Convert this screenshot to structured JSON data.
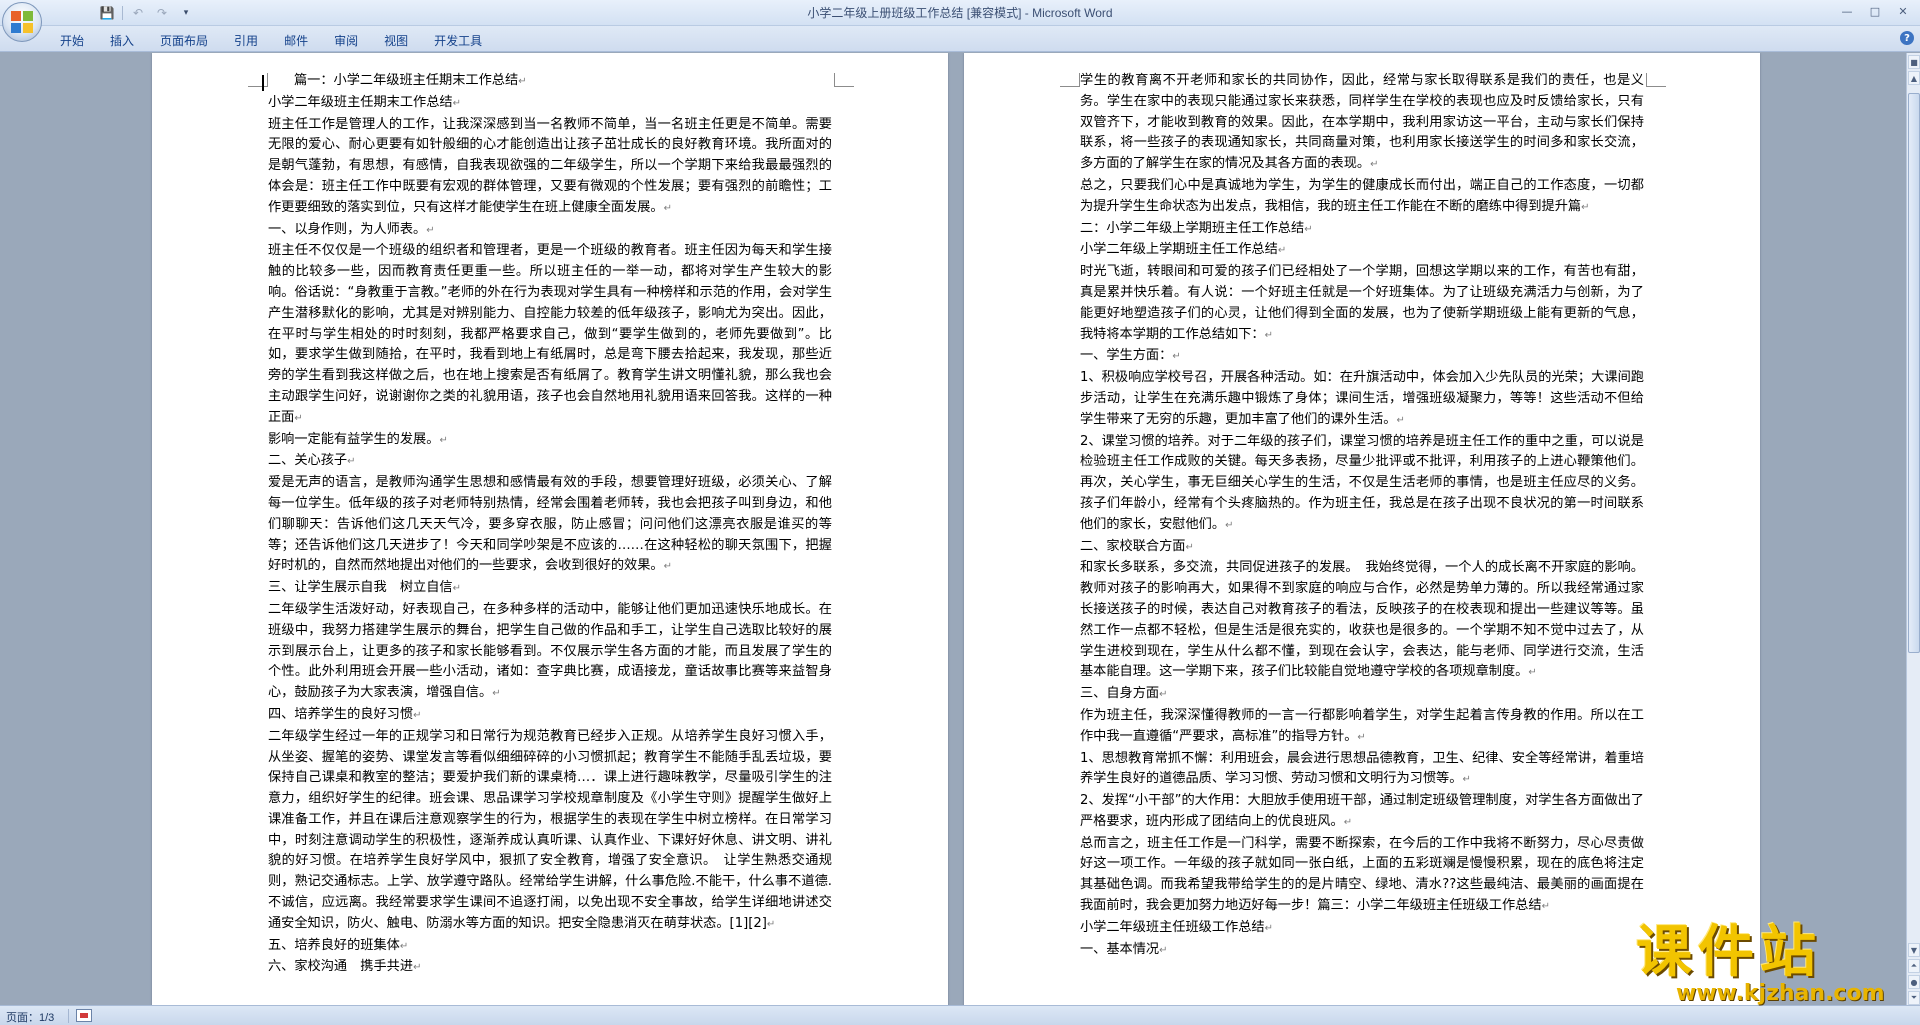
{
  "window": {
    "title": "小学二年级上册班级工作总结 [兼容模式] - ",
    "app_name": "Microsoft Word",
    "controls": {
      "minimize": "—",
      "maximize": "□",
      "close": "✕"
    }
  },
  "quick_access": {
    "save_icon": "save-icon",
    "undo_icon": "undo-icon",
    "redo_icon": "redo-icon",
    "customize_icon": "dropdown-icon"
  },
  "ribbon": {
    "tabs": [
      "开始",
      "插入",
      "页面布局",
      "引用",
      "邮件",
      "审阅",
      "视图",
      "开发工具"
    ],
    "help": "?"
  },
  "left_page": [
    "篇一：小学二年级班主任期末工作总结",
    "小学二年级班主任期末工作总结",
    "班主任工作是管理人的工作，让我深深感到当一名教师不简单，当一名班主任更是不简单。需要无限的爱心、耐心更要有如针般细的心才能创造出让孩子茁壮成长的良好教育环境。我所面对的是朝气蓬勃，有思想，有感情，自我表现欲强的二年级学生，所以一个学期下来给我最最强烈的体会是：班主任工作中既要有宏观的群体管理，又要有微观的个性发展；要有强烈的前瞻性；工作更要细致的落实到位，只有这样才能使学生在班上健康全面发展。",
    "一、以身作则，为人师表。",
    "班主任不仅仅是一个班级的组织者和管理者，更是一个班级的教育者。班主任因为每天和学生接触的比较多一些，因而教育责任更重一些。所以班主任的一举一动，都将对学生产生较大的影响。俗话说：“身教重于言教。”老师的外在行为表现对学生具有一种榜样和示范的作用，会对学生产生潜移默化的影响，尤其是对辨别能力、自控能力较差的低年级孩子，影响尤为突出。因此，在平时与学生相处的时时刻刻，我都严格要求自己，做到“要学生做到的，老师先要做到”。比如，要求学生做到随拾，在平时，我看到地上有纸屑时，总是弯下腰去拾起来，我发现，那些近旁的学生看到我这样做之后，也在地上搜索是否有纸屑了。教育学生讲文明懂礼貌，那么我也会主动跟学生问好，说谢谢你之类的礼貌用语，孩子也会自然地用礼貌用语来回答我。这样的一种正面",
    "影响一定能有益学生的发展。",
    "二、关心孩子",
    "爱是无声的语言，是教师沟通学生思想和感情最有效的手段，想要管理好班级，必须关心、了解每一位学生。低年级的孩子对老师特别热情，经常会围着老师转，我也会把孩子叫到身边，和他们聊聊天：告诉他们这几天天气冷，要多穿衣服，防止感冒；问问他们这漂亮衣服是谁买的等等；还告诉他们这几天进步了！今天和同学吵架是不应该的……在这种轻松的聊天氛围下，把握好时机的，自然而然地提出对他们的一些要求，会收到很好的效果。",
    "三、让学生展示自我　树立自信",
    "二年级学生活泼好动，好表现自己，在多种多样的活动中，能够让他们更加迅速快乐地成长。在班级中，我努力搭建学生展示的舞台，把学生自己做的作品和手工，让学生自己选取比较好的展示到展示台上，让更多的孩子和家长能够看到。不仅展示学生各方面的才能，而且发展了学生的个性。此外利用班会开展一些小活动，诸如：查字典比赛，成语接龙，童话故事比赛等来益智身心，鼓励孩子为大家表演，增强自信。",
    "四、培养学生的良好习惯",
    "二年级学生经过一年的正规学习和日常行为规范教育已经步入正规。从培养学生良好习惯入手，从坐姿、握笔的姿势、课堂发言等看似细细碎碎的小习惯抓起；教育学生不能随手乱丢垃圾，要保持自己课桌和教室的整洁；要爱护我们新的课桌椅…．课上进行趣味教学，尽量吸引学生的注意力，组织好学生的纪律。班会课、思品课学习学校规章制度及《小学生守则》提醒学生做好上课准备工作，并且在课后注意观察学生的行为，根据学生的表现在学生中树立榜样。在日常学习中，时刻注意调动学生的积极性，逐渐养成认真听课、认真作业、下课好好休息、讲文明、讲礼貌的好习惯。在培养学生良好学风中，狠抓了安全教育，增强了安全意识。　让学生熟悉交通规则，熟记交通标志。上学、放学遵守路队。经常给学生讲解，什么事危险.不能干，什么事不道德.不诚信，应远离。我经常要求学生课间不追逐打闹，以免出现不安全事故，给学生详细地讲述交通安全知识，防火、触电、防溺水等方面的知识。把安全隐患消灭在萌芽状态。[1][2]",
    "五、培养良好的班集体",
    "六、家校沟通　携手共进"
  ],
  "right_page": [
    "学生的教育离不开老师和家长的共同协作，因此，经常与家长取得联系是我们的责任，也是义务。学生在家中的表现只能通过家长来获悉，同样学生在学校的表现也应及时反馈给家长，只有双管齐下，才能收到教育的效果。因此，在本学期中，我利用家访这一平台，主动与家长们保持联系，将一些孩子的表现通知家长，共同商量对策，也利用家长接送学生的时间多和家长交流，多方面的了解学生在家的情况及其各方面的表现。",
    "总之，只要我们心中是真诚地为学生，为学生的健康成长而付出，端正自己的工作态度，一切都为提升学生生命状态为出发点，我相信，我的班主任工作能在不断的磨练中得到提升篇",
    "二：小学二年级上学期班主任工作总结",
    "小学二年级上学期班主任工作总结",
    "时光飞逝，转眼间和可爱的孩子们已经相处了一个学期，回想这学期以来的工作，有苦也有甜，真是累并快乐着。有人说：一个好班主任就是一个好班集体。为了让班级充满活力与创新，为了能更好地塑造孩子们的心灵，让他们得到全面的发展，也为了使新学期班级上能有更新的气息，我特将本学期的工作总结如下：",
    "一、学生方面：",
    "1、积极响应学校号召，开展各种活动。如：在升旗活动中，体会加入少先队员的光荣；大课间跑步活动，让学生在充满乐趣中锻炼了身体；课间生活，增强班级凝聚力，等等！这些活动不但给学生带来了无穷的乐趣，更加丰富了他们的课外生活。",
    "2、课堂习惯的培养。对于二年级的孩子们，课堂习惯的培养是班主任工作的重中之重，可以说是检验班主任工作成败的关键。每天多表扬，尽量少批评或不批评，利用孩子的上进心鞭策他们。再次，关心学生，事无巨细关心学生的生活，不仅是生活老师的事情，也是班主任应尽的义务。孩子们年龄小，经常有个头疼脑热的。作为班主任，我总是在孩子出现不良状况的第一时间联系他们的家长，安慰他们。",
    "二、家校联合方面",
    "和家长多联系，多交流，共同促进孩子的发展。　我始终觉得，一个人的成长离不开家庭的影响。教师对孩子的影响再大，如果得不到家庭的响应与合作，必然是势单力薄的。所以我经常通过家长接送孩子的时候，表达自己对教育孩子的看法，反映孩子的在校表现和提出一些建议等等。虽然工作一点都不轻松，但是生活是很充实的，收获也是很多的。一个学期不知不觉中过去了，从学生进校到现在，学生从什么都不懂，到现在会认字，会表达，能与老师、同学进行交流，生活基本能自理。这一学期下来，孩子们比较能自觉地遵守学校的各项规章制度。",
    "三、自身方面",
    "作为班主任，我深深懂得教师的一言一行都影响着学生，对学生起着言传身教的作用。所以在工作中我一直遵循“严要求，高标准”的指导方针。",
    "1、思想教育常抓不懈：利用班会，晨会进行思想品德教育，卫生、纪律、安全等经常讲，着重培养学生良好的道德品质、学习习惯、劳动习惯和文明行为习惯等。",
    "2、发挥“小干部”的大作用：大胆放手使用班干部，通过制定班级管理制度，对学生各方面做出了严格要求，班内形成了团结向上的优良班风。",
    "总而言之，班主任工作是一门科学，需要不断探索，在今后的工作中我将不断努力，尽心尽责做好这一项工作。一年级的孩子就如同一张白纸，上面的五彩斑斓是慢慢积累，现在的底色将注定其基础色调。而我希望我带给学生的的是片晴空、绿地、清水??这些最纯洁、最美丽的画面提在我面前时，我会更加努力地迈好每一步！篇三：小学二年级班主任班级工作总结",
    "小学二年级班主任班级工作总结",
    "一、基本情况"
  ],
  "status": {
    "page": "页面：1/3"
  },
  "watermark": {
    "big": "课件站",
    "url": "www.kjzhan.com"
  },
  "colors": {
    "title_accent": "#1f5fb8",
    "watermark": "#f2c400"
  }
}
